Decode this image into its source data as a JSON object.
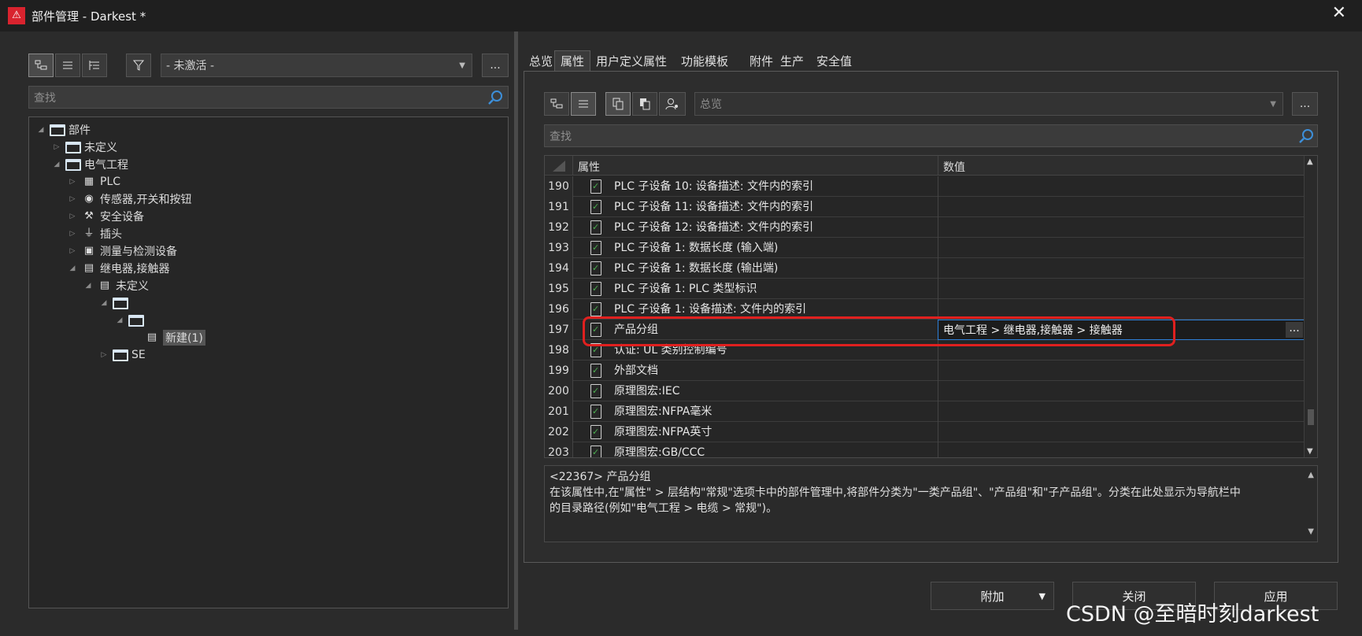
{
  "window": {
    "title": "部件管理 - Darkest *",
    "close": "✕"
  },
  "left_toolbar": {
    "filter_value": "- 未激活 -",
    "more_label": "...",
    "search_placeholder": "查找"
  },
  "tree": [
    {
      "label": "部件",
      "icon": "folder-icon",
      "level": 0,
      "expand": "◢"
    },
    {
      "label": "未定义",
      "icon": "folder-icon",
      "level": 1,
      "expand": "▷"
    },
    {
      "label": "电气工程",
      "icon": "folder-icon",
      "level": 1,
      "expand": "◢"
    },
    {
      "label": "PLC",
      "icon": "plc-icon",
      "level": 2,
      "expand": "▷"
    },
    {
      "label": "传感器,开关和按钮",
      "icon": "sensor-icon",
      "level": 2,
      "expand": "▷"
    },
    {
      "label": "安全设备",
      "icon": "safety-icon",
      "level": 2,
      "expand": "▷"
    },
    {
      "label": "插头",
      "icon": "plug-icon",
      "level": 2,
      "expand": "▷"
    },
    {
      "label": "测量与检测设备",
      "icon": "meter-icon",
      "level": 2,
      "expand": "▷"
    },
    {
      "label": "继电器,接触器",
      "icon": "relay-icon",
      "level": 2,
      "expand": "◢"
    },
    {
      "label": "未定义",
      "icon": "relay-icon",
      "level": 3,
      "expand": "◢"
    },
    {
      "label": "",
      "icon": "folder-icon",
      "level": 4,
      "expand": "◢"
    },
    {
      "label": "",
      "icon": "folder-icon",
      "level": 5,
      "expand": "◢"
    },
    {
      "label": "新建(1)",
      "icon": "relay-icon",
      "level": 6,
      "expand": "",
      "selected": true
    },
    {
      "label": "SE",
      "icon": "folder-icon",
      "level": 4,
      "expand": "▷"
    }
  ],
  "tabs": [
    "总览",
    "属性",
    "用户定义属性",
    "功能模板",
    "附件",
    "生产",
    "安全值"
  ],
  "active_tab": 1,
  "right_toolbar": {
    "view_placeholder": "总览",
    "more_label": "...",
    "search_placeholder": "查找"
  },
  "grid": {
    "col_property": "属性",
    "col_value": "数值",
    "rows": [
      {
        "num": "190",
        "name": "PLC 子设备 10: 设备描述: 文件内的索引",
        "value": ""
      },
      {
        "num": "191",
        "name": "PLC 子设备 11: 设备描述: 文件内的索引",
        "value": ""
      },
      {
        "num": "192",
        "name": "PLC 子设备 12: 设备描述: 文件内的索引",
        "value": ""
      },
      {
        "num": "193",
        "name": "PLC 子设备 1: 数据长度 (输入端)",
        "value": ""
      },
      {
        "num": "194",
        "name": "PLC 子设备 1: 数据长度 (输出端)",
        "value": ""
      },
      {
        "num": "195",
        "name": "PLC 子设备 1: PLC 类型标识",
        "value": ""
      },
      {
        "num": "196",
        "name": "PLC 子设备 1: 设备描述: 文件内的索引",
        "value": ""
      },
      {
        "num": "197",
        "name": "产品分组",
        "value": "电气工程 > 继电器,接触器 > 接触器",
        "selected": true
      },
      {
        "num": "198",
        "name": "认证: UL 类别控制编号",
        "value": ""
      },
      {
        "num": "199",
        "name": "外部文档",
        "value": ""
      },
      {
        "num": "200",
        "name": "原理图宏:IEC",
        "value": ""
      },
      {
        "num": "201",
        "name": "原理图宏:NFPA毫米",
        "value": ""
      },
      {
        "num": "202",
        "name": "原理图宏:NFPA英寸",
        "value": ""
      },
      {
        "num": "203",
        "name": "原理图宏:GB/CCC",
        "value": ""
      }
    ],
    "cell_more": "..."
  },
  "description": {
    "line1": "<22367> 产品分组",
    "line2": "在该属性中,在\"属性\" > 层结构\"常规\"选项卡中的部件管理中,将部件分类为\"一类产品组\"、\"产品组\"和\"子产品组\"。分类在此处显示为导航栏中",
    "line3": "的目录路径(例如\"电气工程 > 电缆 > 常规\")。"
  },
  "buttons": {
    "add": "附加",
    "close": "关闭",
    "apply": "应用"
  },
  "watermark": "CSDN @至暗时刻darkest",
  "colors": {
    "highlight": "#e0201f",
    "selection_border": "#2e7fd6",
    "accent": "#d9232e"
  }
}
